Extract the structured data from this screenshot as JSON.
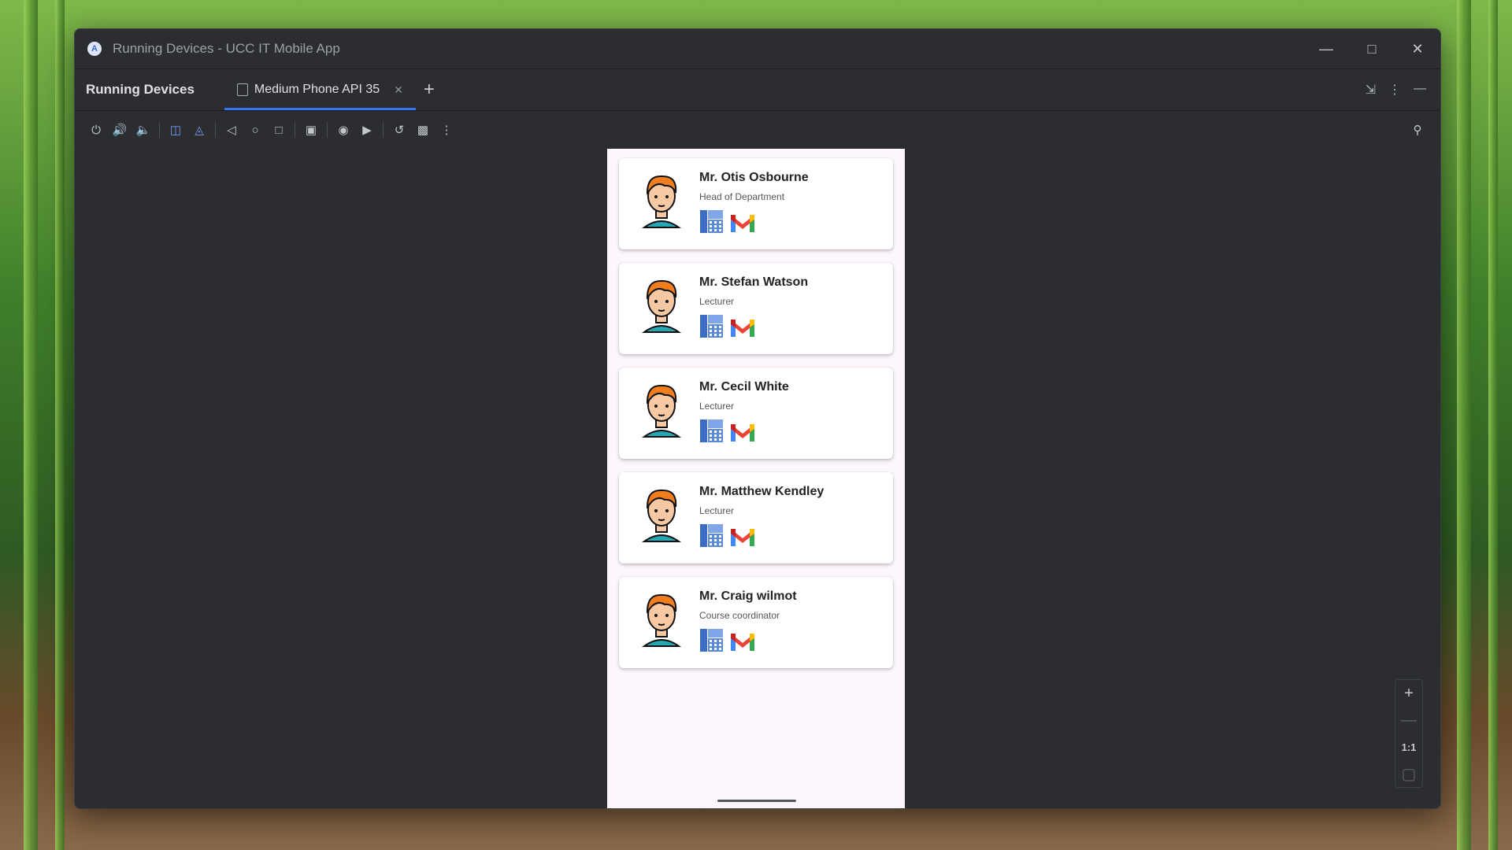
{
  "window": {
    "title": "Running Devices - UCC IT Mobile App"
  },
  "tabbar": {
    "tool_title": "Running Devices",
    "tab_label": "Medium Phone API 35"
  },
  "zoom": {
    "ratio_label": "1:1"
  },
  "contacts": [
    {
      "name": "Mr. Otis Osbourne",
      "role": "Head of Department"
    },
    {
      "name": "Mr. Stefan Watson",
      "role": "Lecturer"
    },
    {
      "name": "Mr. Cecil White",
      "role": "Lecturer"
    },
    {
      "name": "Mr. Matthew Kendley",
      "role": "Lecturer"
    },
    {
      "name": "Mr. Craig wilmot",
      "role": "Course coordinator"
    }
  ]
}
